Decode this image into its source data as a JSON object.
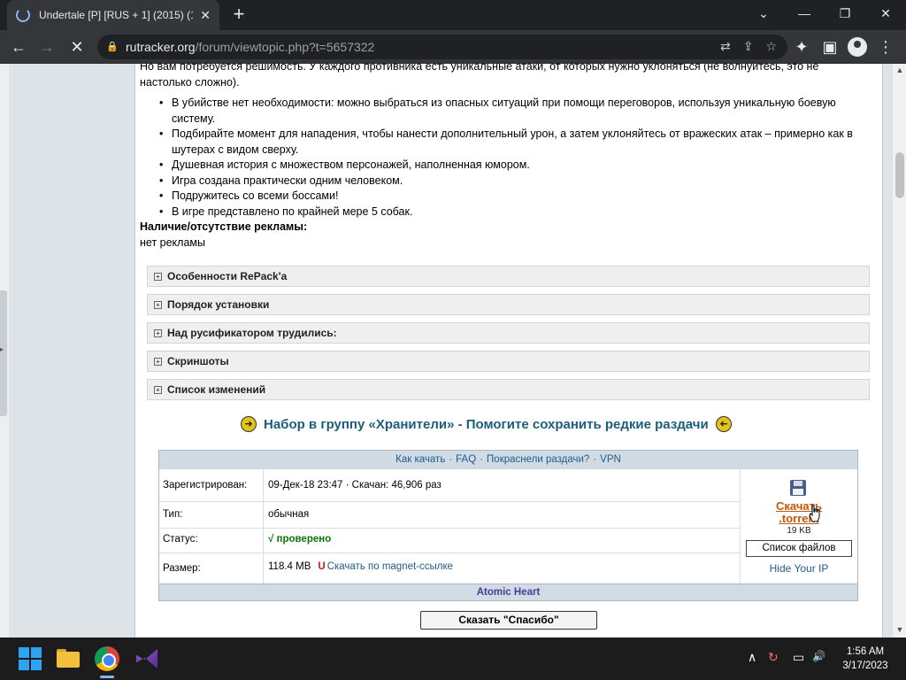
{
  "browser": {
    "tab_title": "Undertale [P] [RUS + 1] (2015) (1",
    "url_host": "rutracker.org",
    "url_path": "/forum/viewtopic.php?t=5657322"
  },
  "post": {
    "intro": "Но вам потребуется решимость. У каждого противника есть уникальные атаки, от которых нужно уклоняться (не волнуйтесь, это не настолько сложно).",
    "bullets": [
      "В убийстве нет необходимости: можно выбраться из опасных ситуаций при помощи переговоров, используя уникальную боевую систему.",
      "Подбирайте момент для нападения, чтобы нанести дополнительный урон, а затем уклоняйтесь от вражеских атак – примерно как в шутерах с видом сверху.",
      "Душевная история с множеством персонажей, наполненная юмором.",
      "Игра создана практически одним человеком.",
      "Подружитесь со всеми боссами!",
      "В игре представлено по крайней мере 5 собак."
    ],
    "ads_label": "Наличие/отсутствие рекламы:",
    "ads_value": "нет рекламы",
    "spoilers": [
      "Особенности RePack'a",
      "Порядок установки",
      "Над русификатором трудились:",
      "Скриншоты",
      "Список изменений"
    ],
    "spoiler_toggle": "+"
  },
  "promo": {
    "text": "Набор в группу «Хранители» - Помогите сохранить редкие раздачи",
    "arrow": "➜"
  },
  "torrent": {
    "head_links": [
      "Как качать",
      "FAQ",
      "Покраснели раздачи?",
      "VPN"
    ],
    "head_sep": "·",
    "registered_label": "Зарегистрирован:",
    "registered_value": "09-Дек-18 23:47 · Скачан: 46,906 раз",
    "type_label": "Тип:",
    "type_value": "обычная",
    "status_label": "Статус:",
    "status_check": "√",
    "status_value": "проверено",
    "size_label": "Размер:",
    "size_value": "118.4 MB",
    "magnet_icon": "U",
    "magnet_link": "Скачать по magnet-ссылке",
    "download_link": "Скачать .torrent",
    "download_size": "19 KB",
    "files_button": "Список файлов",
    "hide_ip": "Hide Your IP",
    "footer": "Atomic Heart"
  },
  "thanks_button": "Сказать \"Спасибо\"",
  "taskbar": {
    "time": "1:56 AM",
    "date": "3/17/2023"
  },
  "icons": {
    "tab_close": "✕",
    "new_tab": "+",
    "minimize": "—",
    "maximize": "❐",
    "close": "✕",
    "chevron": "⌄",
    "back": "←",
    "forward": "→",
    "stop": "✕",
    "lock": "🔒",
    "translate": "⇄",
    "share": "⇪",
    "star": "☆",
    "extensions": "✦",
    "sidepanel": "▣",
    "menu": "⋮",
    "tray_chevron": "∧",
    "tray_sync": "↻",
    "tray_display": "▭",
    "tray_volume": "🔊",
    "scroll_up": "▲",
    "scroll_down": "▼",
    "left_arrow": "▸"
  }
}
